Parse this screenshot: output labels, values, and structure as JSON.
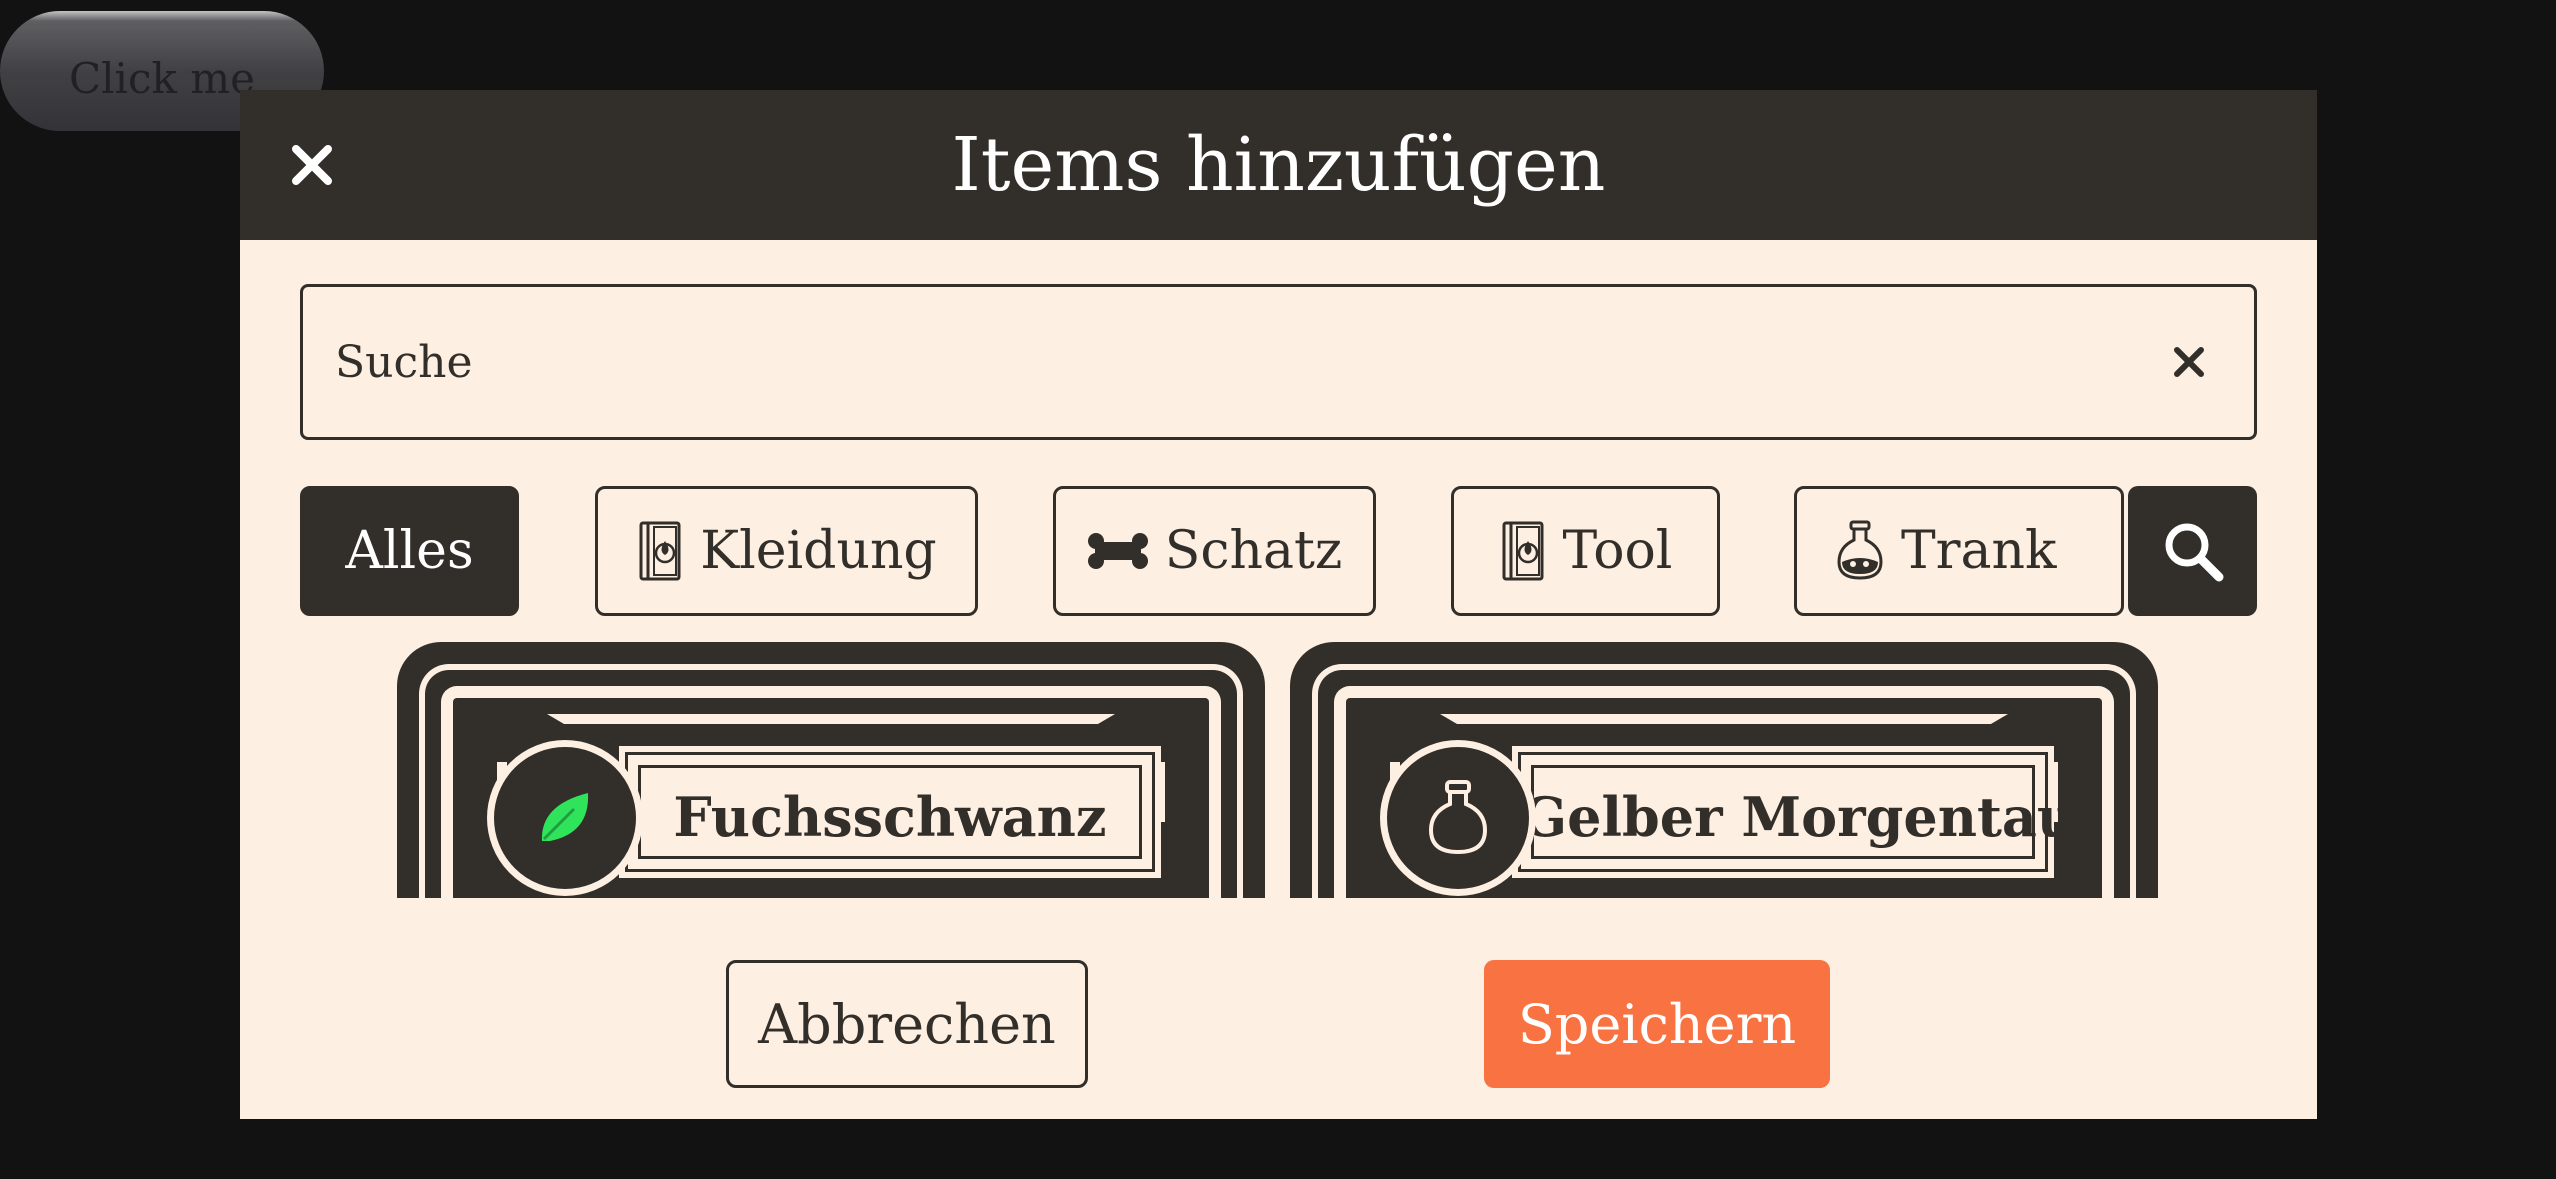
{
  "background_button": {
    "label": "Click me"
  },
  "modal": {
    "title": "Items hinzufügen",
    "close_icon": "close-icon"
  },
  "search": {
    "placeholder": "Suche",
    "value": "",
    "clear_icon": "close-icon"
  },
  "filters": [
    {
      "label": "Alles",
      "active": true
    },
    {
      "label": "Kleidung",
      "icon": "book-icon"
    },
    {
      "label": "Schatz",
      "icon": "bone-icon"
    },
    {
      "label": "Tool",
      "icon": "book-icon"
    },
    {
      "label": "Trank",
      "icon": "potion-icon"
    }
  ],
  "search_button": {
    "icon": "magnifier-icon"
  },
  "items": [
    {
      "name": "Fuchsschwanz",
      "icon": "leaf-icon"
    },
    {
      "name": "Gelber Morgentau",
      "icon": "flask-icon"
    }
  ],
  "footer": {
    "cancel_label": "Abbrechen",
    "save_label": "Speichern"
  },
  "colors": {
    "dark": "#322e29",
    "cream": "#fdefe2",
    "accent": "#f97241",
    "leaf": "#2fe35b",
    "page_bg": "#121213"
  }
}
